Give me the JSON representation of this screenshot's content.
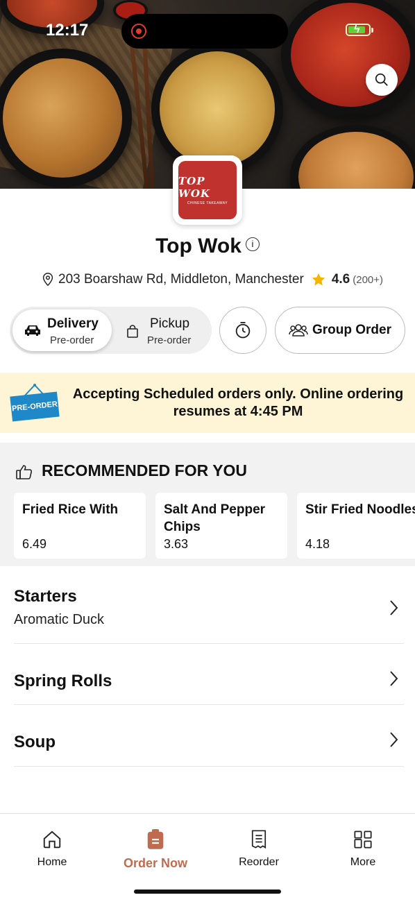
{
  "status_bar": {
    "time": "12:17"
  },
  "restaurant": {
    "name": "Top Wok",
    "logo_title": "TOP WOK",
    "logo_subtitle": "CHINESE TAKEAWAY",
    "address": "203 Boarshaw Rd, Middleton, Manchester",
    "rating": "4.6",
    "rating_count": "(200+)"
  },
  "order_mode": {
    "delivery_label": "Delivery",
    "delivery_sub": "Pre-order",
    "pickup_label": "Pickup",
    "pickup_sub": "Pre-order",
    "group_order_label": "Group Order",
    "selected": "delivery"
  },
  "banner": {
    "sign_text": "PRE-ORDER",
    "message": "Accepting Scheduled orders only. Online ordering resumes at 4:45 PM"
  },
  "recommended": {
    "title": "RECOMMENDED FOR YOU",
    "items": [
      {
        "name": "Fried Rice With",
        "price": "6.49"
      },
      {
        "name": "Salt And Pepper\nChips",
        "price": "3.63"
      },
      {
        "name": "Stir Fried Noodles",
        "price": "4.18"
      }
    ]
  },
  "categories": [
    {
      "title": "Starters",
      "subtitle": "Aromatic Duck"
    },
    {
      "title": "Spring Rolls",
      "subtitle": ""
    },
    {
      "title": "Soup",
      "subtitle": ""
    }
  ],
  "tabs": [
    {
      "label": "Home",
      "icon": "home-icon"
    },
    {
      "label": "Order Now",
      "icon": "order-icon"
    },
    {
      "label": "Reorder",
      "icon": "receipt-icon"
    },
    {
      "label": "More",
      "icon": "grid-icon"
    }
  ],
  "active_tab": "Order Now",
  "colors": {
    "accent": "#c06a4f",
    "banner_bg": "#fdf5d5",
    "star": "#f5b400",
    "logo_red": "#c0322e"
  }
}
